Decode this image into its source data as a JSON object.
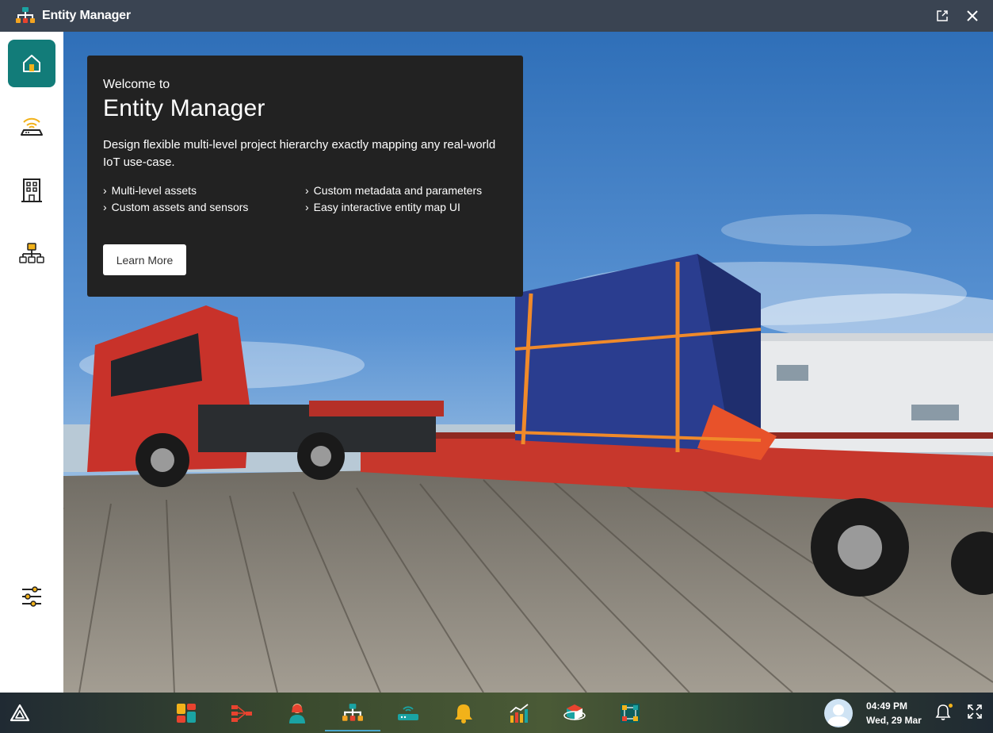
{
  "app": {
    "title": "Entity Manager",
    "accent_color": "#127c79"
  },
  "titlebar": {
    "actions": [
      "popout-icon",
      "close-icon"
    ]
  },
  "sidebar": {
    "items": [
      {
        "name": "home",
        "icon": "home-icon",
        "active": true
      },
      {
        "name": "gateway",
        "icon": "wifi-router-icon",
        "active": false
      },
      {
        "name": "buildings",
        "icon": "building-icon",
        "active": false
      },
      {
        "name": "hierarchy",
        "icon": "hierarchy-icon",
        "active": false
      }
    ],
    "bottom_item": {
      "name": "settings",
      "icon": "sliders-icon"
    }
  },
  "welcome": {
    "subtitle": "Welcome to",
    "title": "Entity Manager",
    "description": "Design flexible multi-level project hierarchy exactly mapping any real-world IoT use-case.",
    "features": [
      "Multi-level assets",
      "Custom metadata and parameters",
      "Custom assets and sensors",
      "Easy interactive entity map UI"
    ],
    "button_label": "Learn More"
  },
  "taskbar": {
    "apps": [
      {
        "name": "dashboard",
        "icon": "dashboard-icon",
        "active": false
      },
      {
        "name": "flows",
        "icon": "flow-icon",
        "active": false
      },
      {
        "name": "users",
        "icon": "user-icon",
        "active": false
      },
      {
        "name": "entity-manager",
        "icon": "hierarchy-icon",
        "active": true
      },
      {
        "name": "gateways",
        "icon": "router-icon",
        "active": false
      },
      {
        "name": "alerts",
        "icon": "bell-icon",
        "active": false
      },
      {
        "name": "analytics",
        "icon": "chart-icon",
        "active": false
      },
      {
        "name": "3d-objects",
        "icon": "cube-icon",
        "active": false
      },
      {
        "name": "map",
        "icon": "map-icon",
        "active": false
      }
    ],
    "time": "04:49 PM",
    "date": "Wed, 29 Mar"
  }
}
